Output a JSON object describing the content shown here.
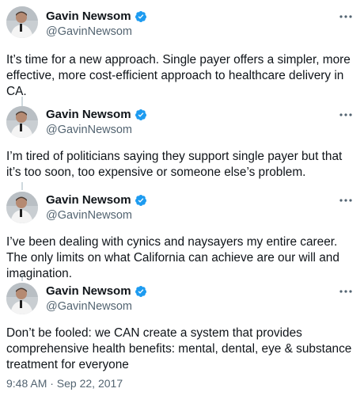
{
  "author": {
    "name": "Gavin Newsom",
    "handle": "@GavinNewsom",
    "verified_color": "#1d9bf0",
    "avatar_icon": "person-avatar"
  },
  "tweets": [
    {
      "text": "It’s time for a new approach. Single payer offers a simpler, more effective, more cost-efficient approach to healthcare delivery in CA."
    },
    {
      "text": "I’m tired of politicians saying they support single payer but that it’s too soon, too expensive or someone else’s problem."
    },
    {
      "text": "I’ve been dealing with cynics and naysayers my entire career. The only limits on what California can achieve are our will and imagination."
    },
    {
      "text": "Don’t be fooled: we CAN create a system that provides comprehensive health benefits: mental, dental, eye & substance treatment for everyone"
    }
  ],
  "timestamp": "9:48 AM · Sep 22, 2017",
  "icons": {
    "more": "more-options-icon",
    "verified": "verified-badge-icon"
  }
}
